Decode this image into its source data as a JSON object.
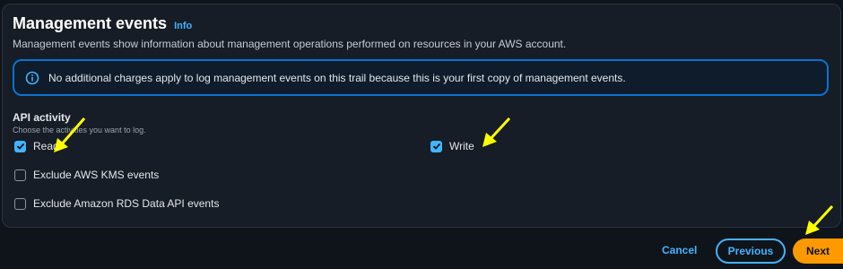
{
  "section": {
    "title": "Management events",
    "info_link": "Info",
    "description": "Management events show information about management operations performed on resources in your AWS account."
  },
  "alert": {
    "icon": "info-circle-icon",
    "text": "No additional charges apply to log management events on this trail because this is your first copy of management events."
  },
  "api_activity": {
    "label": "API activity",
    "hint": "Choose the activities you want to log.",
    "options": [
      {
        "label": "Read",
        "checked": true
      },
      {
        "label": "Write",
        "checked": true
      },
      {
        "label": "Exclude AWS KMS events",
        "checked": false
      },
      {
        "label": "Exclude Amazon RDS Data API events",
        "checked": false
      }
    ]
  },
  "actions": {
    "cancel": "Cancel",
    "previous": "Previous",
    "next": "Next"
  },
  "colors": {
    "accent": "#42b4ff",
    "primary_button": "#ff9900",
    "annotation_arrow": "#ffff00"
  }
}
